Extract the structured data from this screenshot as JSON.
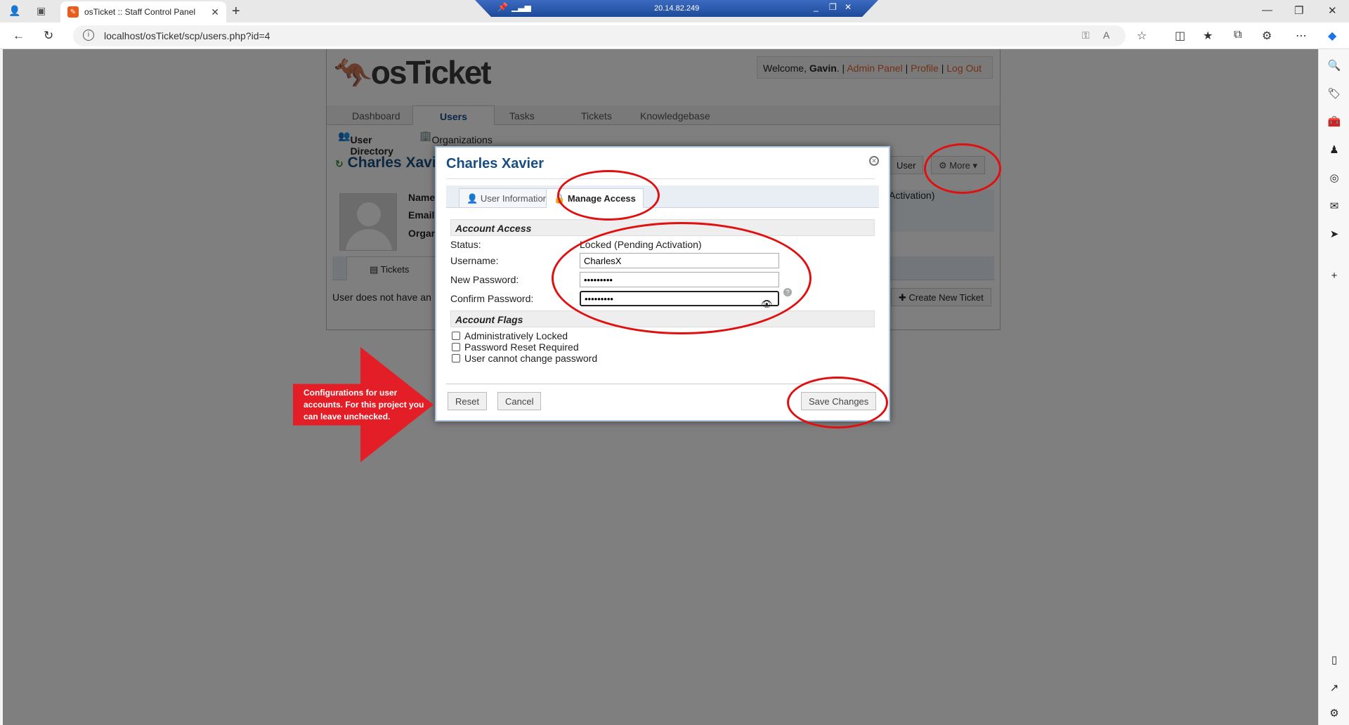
{
  "browser": {
    "tab_title": "osTicket :: Staff Control Panel",
    "url": "localhost/osTicket/scp/users.php?id=4",
    "remote_ip": "20.14.82.249"
  },
  "header": {
    "logo_text": "osTicket",
    "welcome_prefix": "Welcome,",
    "user_name": "Gavin",
    "admin_panel": "Admin Panel",
    "profile": "Profile",
    "logout": "Log Out"
  },
  "nav": {
    "items": [
      "Dashboard",
      "Users",
      "Tasks",
      "Tickets",
      "Knowledgebase"
    ],
    "active": "Users"
  },
  "subnav": {
    "user_directory": "User Directory",
    "organizations": "Organizations"
  },
  "user_page": {
    "title": "Charles Xavie",
    "user_button": "User",
    "more_button": "More",
    "labels": [
      "Name",
      "Email",
      "Orgar"
    ],
    "extra": "Activation)",
    "tickets_tab": "Tickets",
    "no_tickets": "User does not have an",
    "create_ticket": "Create New Ticket"
  },
  "modal": {
    "title": "Charles Xavier",
    "tabs": [
      "User Information",
      "Manage Access"
    ],
    "active_tab": "Manage Access",
    "account_access": "Account Access",
    "status_label": "Status:",
    "status_value": "Locked (Pending Activation)",
    "username_label": "Username:",
    "username_value": "CharlesX",
    "new_password_label": "New Password:",
    "new_password_value": "•••••••••",
    "confirm_password_label": "Confirm Password:",
    "confirm_password_value": "•••••••••",
    "account_flags": "Account Flags",
    "flags": [
      "Administratively Locked",
      "Password Reset Required",
      "User cannot change password"
    ],
    "reset": "Reset",
    "cancel": "Cancel",
    "save": "Save Changes"
  },
  "annotation": {
    "text": "Configurations for user accounts. For this project you can leave unchecked.",
    "color": "#e41e26"
  }
}
